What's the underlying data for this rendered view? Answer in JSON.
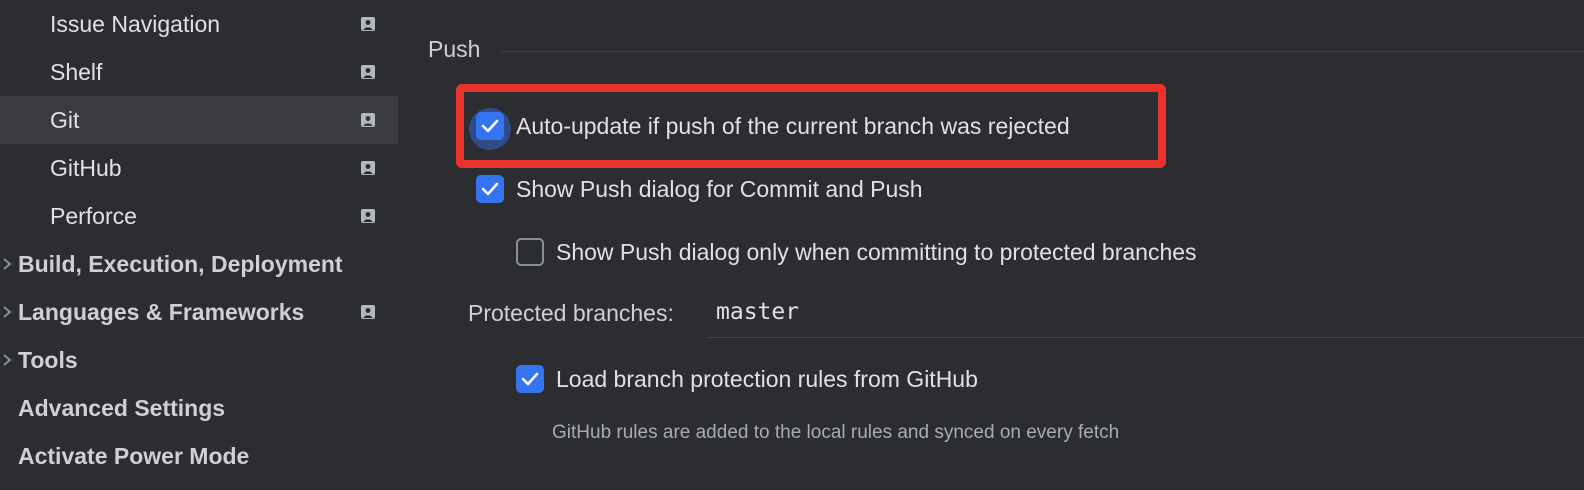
{
  "sidebar": {
    "items": [
      {
        "label": "Issue Navigation",
        "level": "child",
        "project_icon": true,
        "selected": false
      },
      {
        "label": "Shelf",
        "level": "child",
        "project_icon": true,
        "selected": false
      },
      {
        "label": "Git",
        "level": "child",
        "project_icon": true,
        "selected": true
      },
      {
        "label": "GitHub",
        "level": "child",
        "project_icon": true,
        "selected": false
      },
      {
        "label": "Perforce",
        "level": "child",
        "project_icon": true,
        "selected": false
      },
      {
        "label": "Build, Execution, Deployment",
        "level": "top",
        "expandable": true,
        "project_icon": false
      },
      {
        "label": "Languages & Frameworks",
        "level": "top",
        "expandable": true,
        "project_icon": true
      },
      {
        "label": "Tools",
        "level": "top",
        "expandable": true,
        "project_icon": false
      },
      {
        "label": "Advanced Settings",
        "level": "top",
        "expandable": false,
        "project_icon": false
      },
      {
        "label": "Activate Power Mode",
        "level": "top",
        "expandable": false,
        "project_icon": false
      }
    ]
  },
  "push": {
    "section_title": "Push",
    "auto_update": {
      "label": "Auto-update if push of the current branch was rejected",
      "checked": true
    },
    "show_push_dialog": {
      "label": "Show Push dialog for Commit and Push",
      "checked": true
    },
    "show_push_protected": {
      "label": "Show Push dialog only when committing to protected branches",
      "checked": false
    },
    "protected_branches_label": "Protected branches:",
    "protected_branches_value": "master",
    "load_rules": {
      "label": "Load branch protection rules from GitHub",
      "checked": true
    },
    "load_rules_hint": "GitHub rules are added to the local rules and synced on every fetch"
  },
  "colors": {
    "background": "#2b2d30",
    "selected_row": "#393b40",
    "accent": "#3574f0",
    "highlight": "#e8322a"
  }
}
